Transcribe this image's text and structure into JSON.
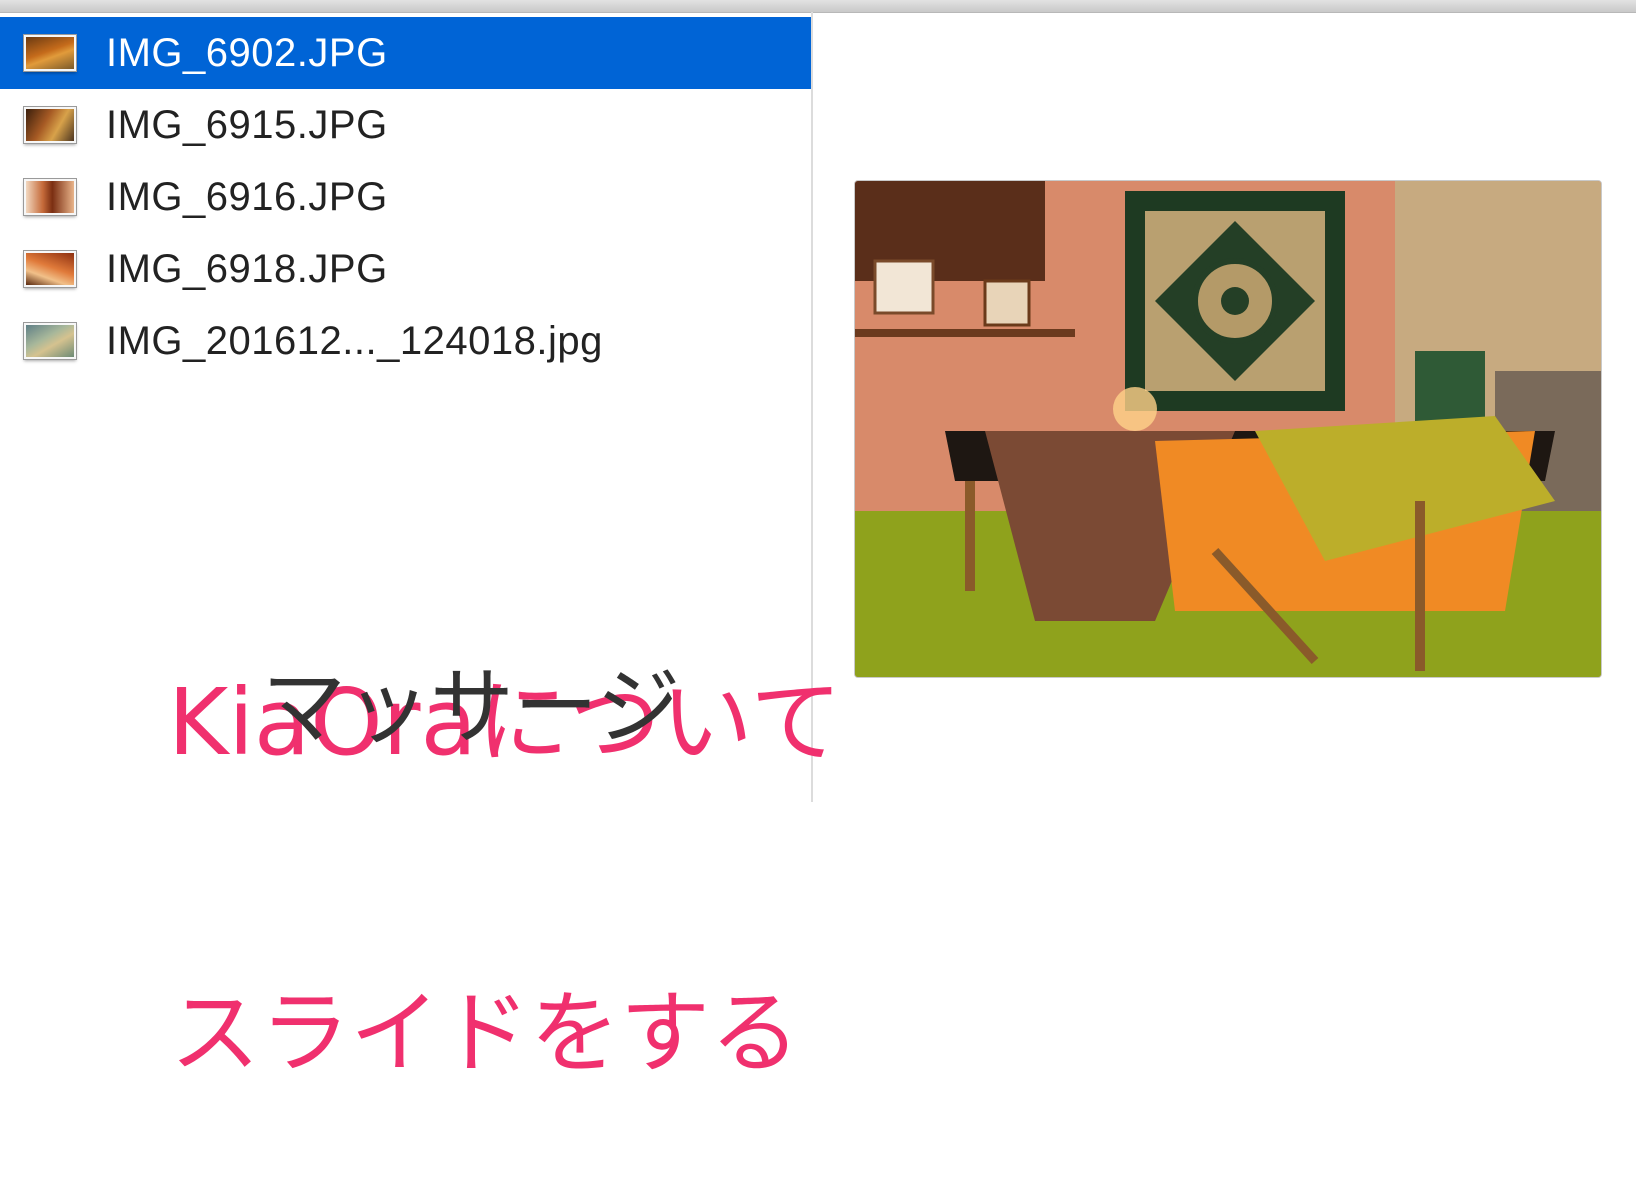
{
  "files": [
    {
      "name": "IMG_6902.JPG",
      "selected": true
    },
    {
      "name": "IMG_6915.JPG",
      "selected": false
    },
    {
      "name": "IMG_6916.JPG",
      "selected": false
    },
    {
      "name": "IMG_6918.JPG",
      "selected": false
    },
    {
      "name": "IMG_201612..._124018.jpg",
      "selected": false
    }
  ],
  "captions": {
    "kiaora": "KiaOraについて",
    "massage": "マッサージ",
    "slide": "スライドをする"
  },
  "colors": {
    "selection": "#0064d6",
    "caption_pink": "#f0306e",
    "caption_dark": "#333333"
  }
}
